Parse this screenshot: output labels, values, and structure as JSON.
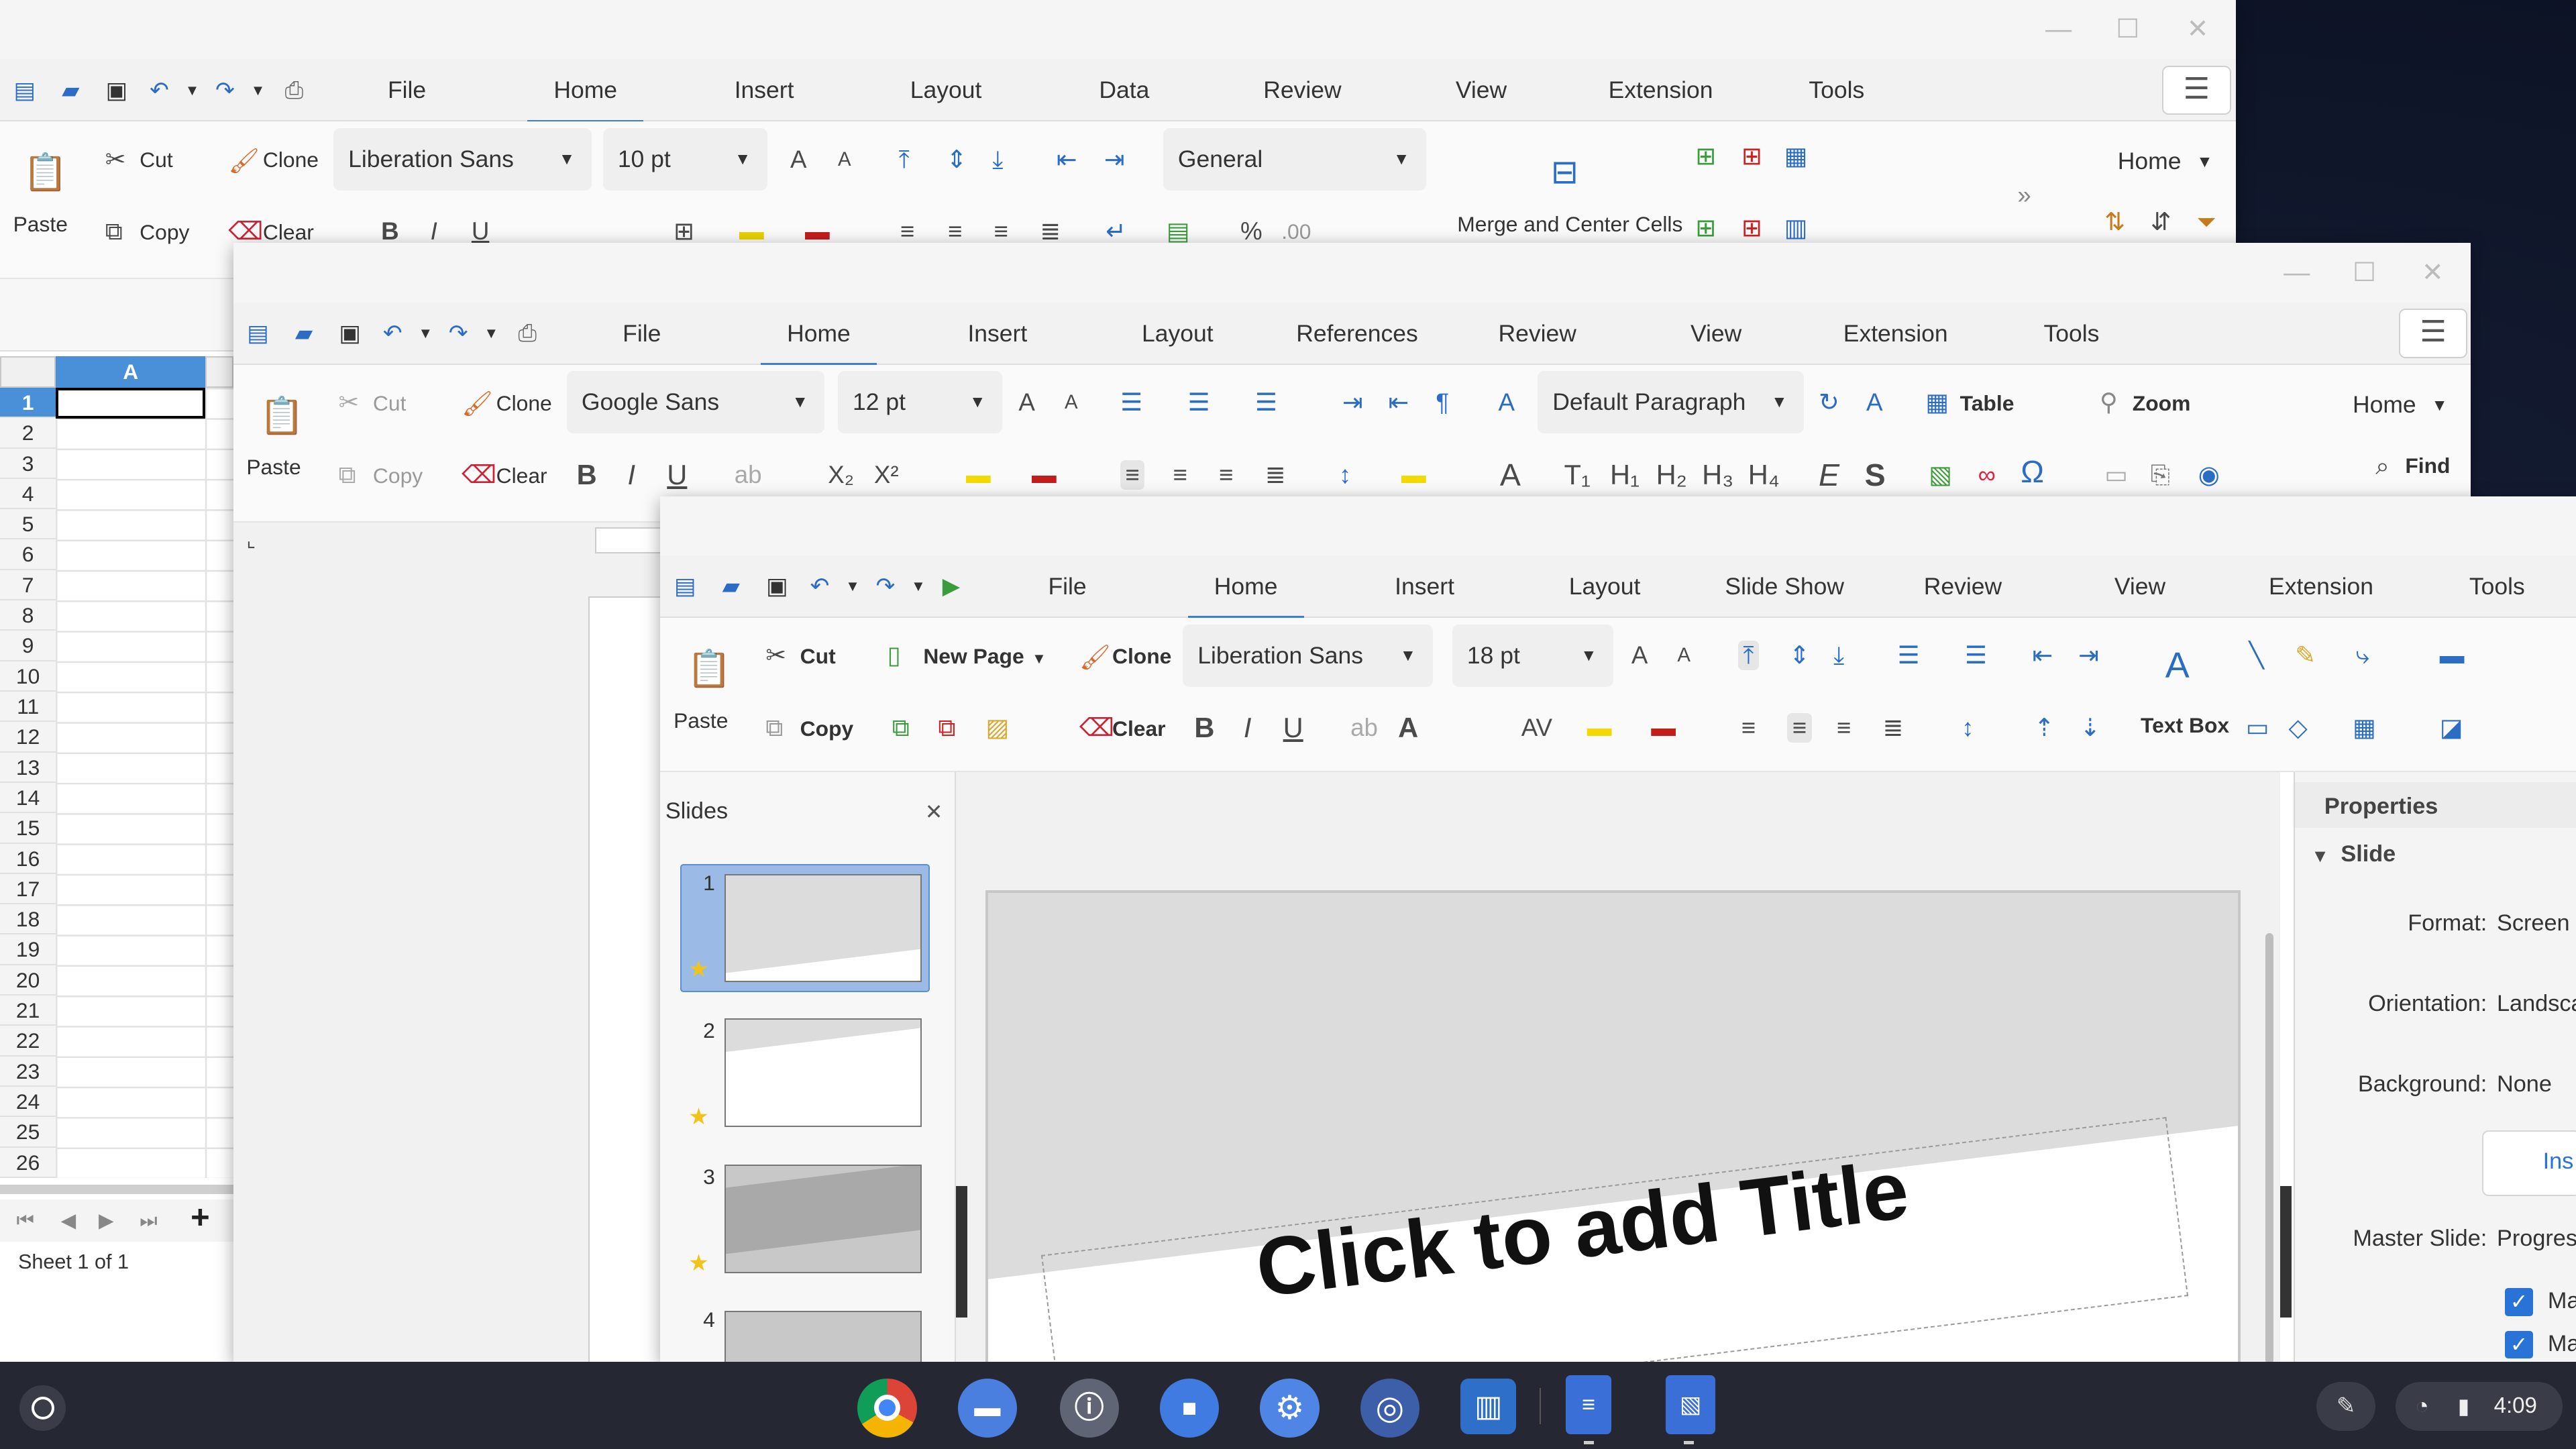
{
  "calc": {
    "menus": [
      "File",
      "Home",
      "Insert",
      "Layout",
      "Data",
      "Review",
      "View",
      "Extension",
      "Tools"
    ],
    "active_menu": "Home",
    "paste": "Paste",
    "cut": "Cut",
    "copy": "Copy",
    "clone": "Clone",
    "clear": "Clear",
    "font": "Liberation Sans",
    "size": "10 pt",
    "number_format": "General",
    "merge": "Merge and Center Cells",
    "home_dropdown": "Home",
    "column_a": "A",
    "rows": [
      "1",
      "2",
      "3",
      "4",
      "5",
      "6",
      "7",
      "8",
      "9",
      "10",
      "11",
      "12",
      "13",
      "14",
      "15",
      "16",
      "17",
      "18",
      "19",
      "20",
      "21",
      "22",
      "23",
      "24",
      "25",
      "26"
    ],
    "sheet_status": "Sheet 1 of 1"
  },
  "writer": {
    "menus": [
      "File",
      "Home",
      "Insert",
      "Layout",
      "References",
      "Review",
      "View",
      "Extension",
      "Tools"
    ],
    "active_menu": "Home",
    "paste": "Paste",
    "cut": "Cut",
    "copy": "Copy",
    "clone": "Clone",
    "clear": "Clear",
    "font": "Google Sans",
    "size": "12 pt",
    "style": "Default Paragraph",
    "table": "Table",
    "zoom": "Zoom",
    "home_dropdown": "Home",
    "find": "Find"
  },
  "impress": {
    "menus": [
      "File",
      "Home",
      "Insert",
      "Layout",
      "Slide Show",
      "Review",
      "View",
      "Extension",
      "Tools"
    ],
    "active_menu": "Home",
    "paste": "Paste",
    "cut": "Cut",
    "copy": "Copy",
    "new_page": "New Page",
    "clone": "Clone",
    "clear": "Clear",
    "font": "Liberation Sans",
    "size": "18 pt",
    "text_box": "Text Box",
    "slides_title": "Slides",
    "slide_numbers": [
      "1",
      "2",
      "3",
      "4"
    ],
    "slide_title_placeholder": "Click to add Title",
    "properties": {
      "title": "Properties",
      "section": "Slide",
      "format_label": "Format:",
      "format_value": "Screen",
      "orientation_label": "Orientation:",
      "orientation_value": "Landsca",
      "background_label": "Background:",
      "background_value": "None",
      "insert_button": "Ins",
      "master_label": "Master Slide:",
      "master_value": "Progres",
      "check1": "Ma",
      "check2": "Ma"
    }
  },
  "shelf": {
    "time": "4:09",
    "apps": [
      "chrome-icon",
      "files-icon",
      "password-icon",
      "video-icon",
      "settings-icon",
      "network-icon",
      "trello-icon",
      "docs-icon",
      "slides-icon"
    ]
  },
  "colors": {
    "accent": "#3a7fd5",
    "check": "#2a73d6",
    "shelf": "#252833"
  }
}
